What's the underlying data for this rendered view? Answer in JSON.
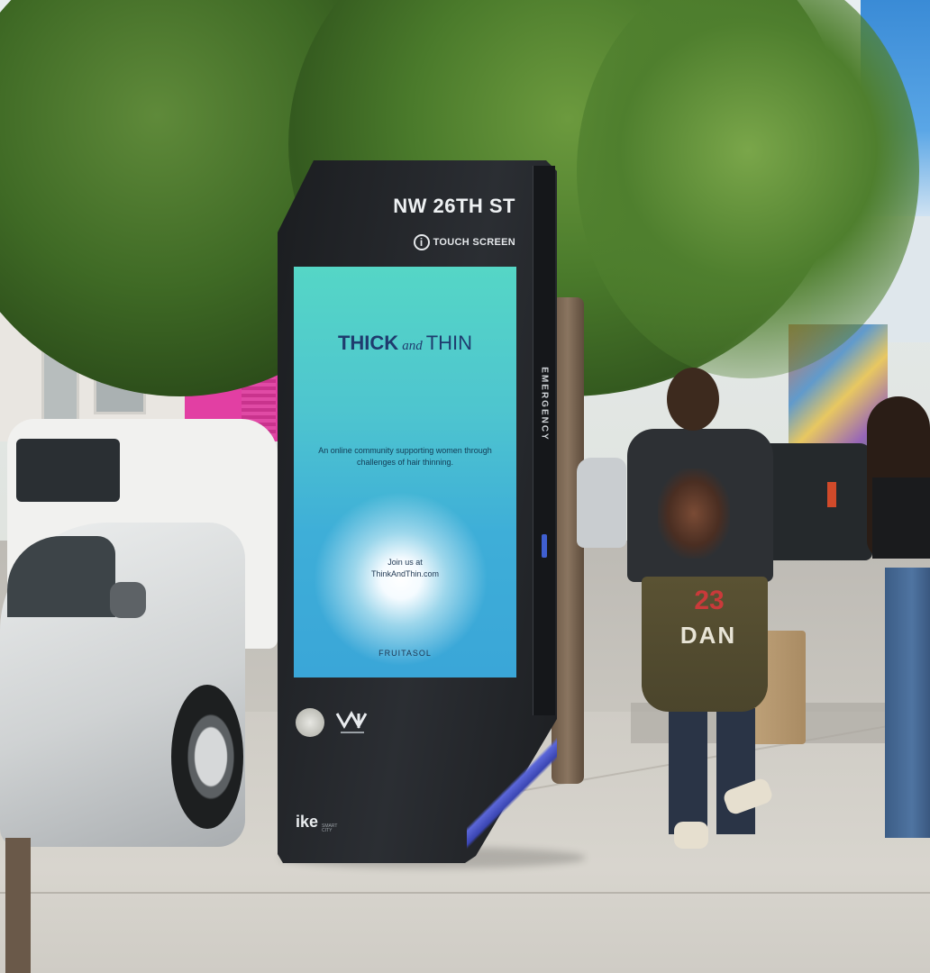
{
  "kiosk": {
    "street_sign": "NW 26TH ST",
    "touch_label": "TOUCH SCREEN",
    "info_glyph": "i",
    "side_label": "EMERGENCY",
    "brand": {
      "word": "ike",
      "sub": "SMART CITY"
    },
    "colors": {
      "body": "#1f2124",
      "accent_blue": "#4b59d0"
    }
  },
  "ad": {
    "title_bold": "THICK",
    "title_connector": "and",
    "title_light": "THIN",
    "tagline": "An online community supporting women through challenges of hair thinning.",
    "cta_line1": "Join us at",
    "cta_line2": "ThinkAndThin.com",
    "sponsor": "FRUITASOL",
    "colors": {
      "gradient_top": "#55d6c6",
      "gradient_bottom": "#3aa6d8",
      "text": "#1f3b6e"
    }
  },
  "pedestrian": {
    "jersey_number": "23",
    "jersey_name": "DAN"
  },
  "icons": [
    "info-icon",
    "city-seal-icon",
    "wynwood-logo-icon"
  ]
}
